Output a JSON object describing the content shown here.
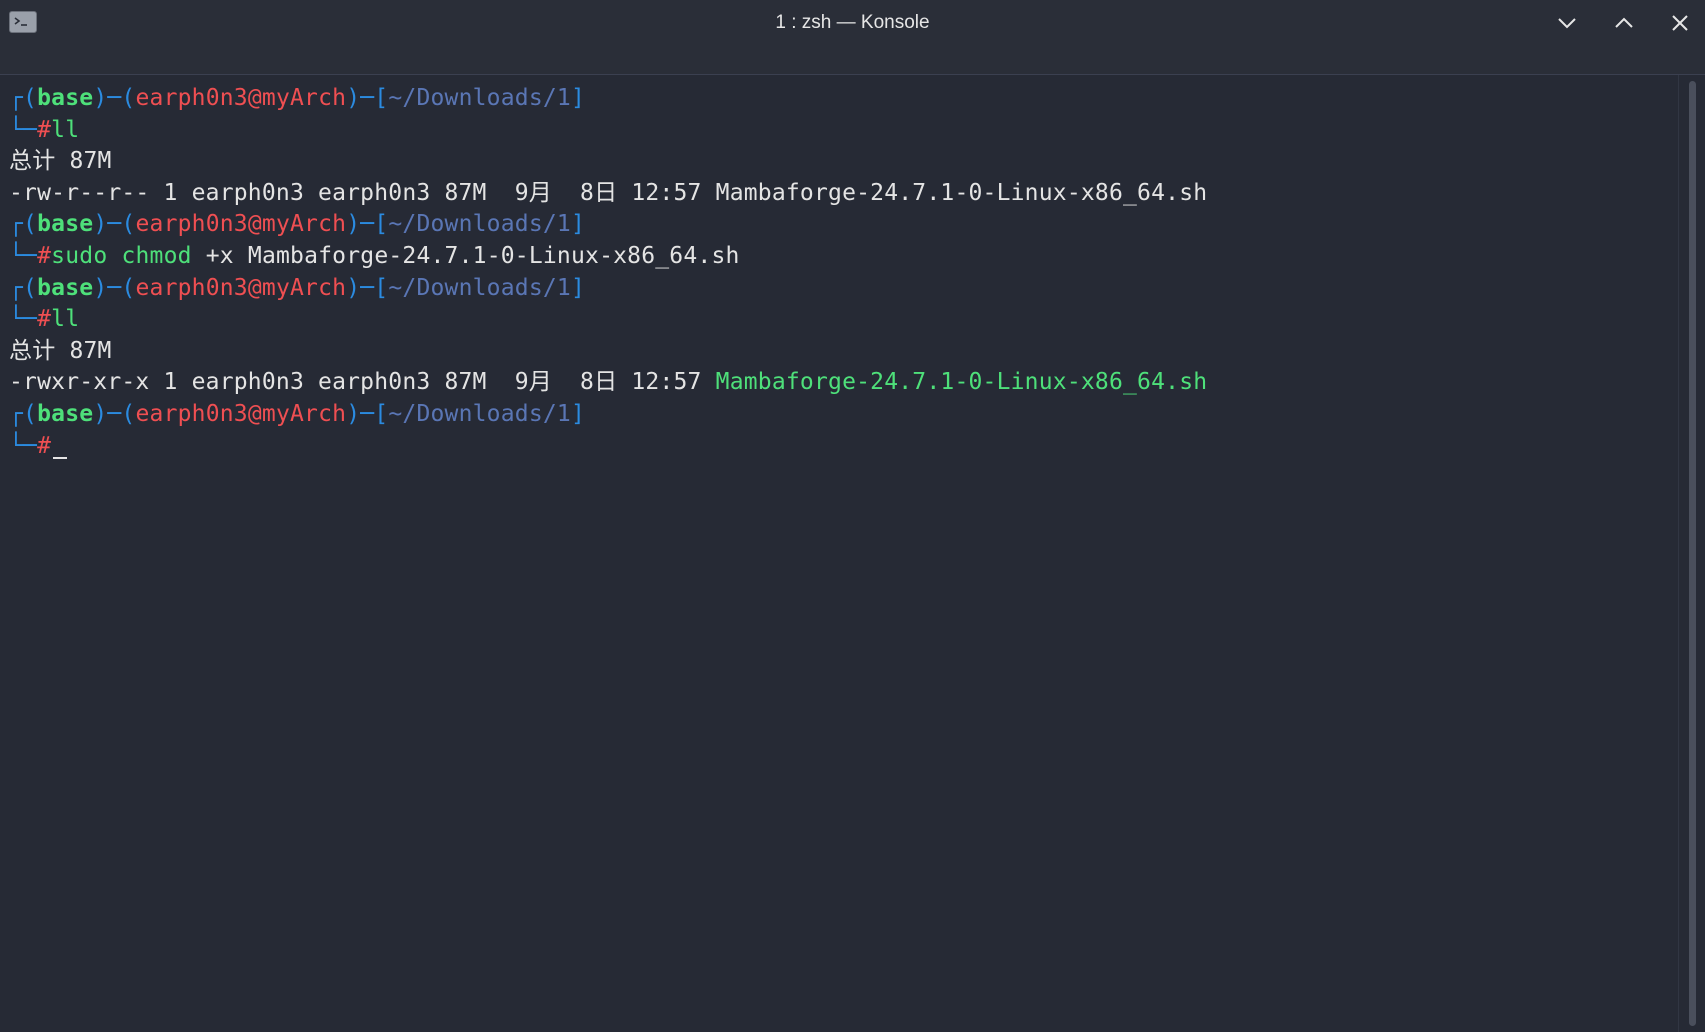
{
  "window": {
    "title": "1 : zsh — Konsole",
    "app_icon": "terminal-icon",
    "controls": [
      "minimize-icon",
      "maximize-icon",
      "close-icon"
    ]
  },
  "prompt": {
    "env": "base",
    "user_host": "earph0n3@myArch",
    "path": "~/Downloads/1",
    "hash": "#"
  },
  "terminal": {
    "cmd1": "ll",
    "total1": "总计 87M",
    "file1_perms": "-rw-r--r-- 1 earph0n3 earph0n3 87M  9月  8日 12:57",
    "file1_name": "Mambaforge-24.7.1-0-Linux-x86_64.sh",
    "cmd2_sudo": "sudo",
    "cmd2_chmod": "chmod",
    "cmd2_args": "+x Mambaforge-24.7.1-0-Linux-x86_64.sh",
    "cmd3": "ll",
    "total2": "总计 87M",
    "file2_perms": "-rwxr-xr-x 1 earph0n3 earph0n3 87M  9月  8日 12:57",
    "file2_name": "Mambaforge-24.7.1-0-Linux-x86_64.sh"
  },
  "colors": {
    "background": "#262a35",
    "box": "#2b8be0",
    "env": "#4ee07a",
    "user": "#ef4f52",
    "path": "#5a76b5",
    "exec_file": "#4ee07a"
  }
}
